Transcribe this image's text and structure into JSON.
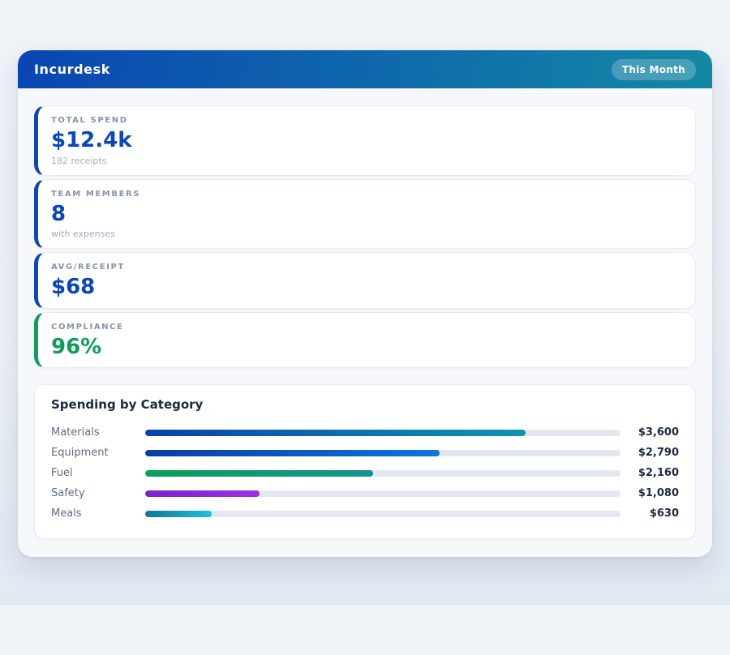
{
  "app": {
    "title": "Incurdesk",
    "period_badge": "This Month"
  },
  "theme": {
    "header_gradient": [
      "#0a45b2",
      "#1389a4"
    ],
    "page_background": "#eef1f6",
    "accent_blue": "#0b46bb",
    "accent_green": "#0f9d58",
    "track_color": "#e3e8f0"
  },
  "stats": [
    {
      "label": "TOTAL SPEND",
      "value": "$12.4k",
      "sub": "182 receipts",
      "accent": "#0b46bb"
    },
    {
      "label": "TEAM MEMBERS",
      "value": "8",
      "sub": "with expenses",
      "accent": "#0b46bb"
    },
    {
      "label": "AVG/RECEIPT",
      "value": "$68",
      "sub": "",
      "accent": "#0b46bb"
    },
    {
      "label": "COMPLIANCE",
      "value": "96%",
      "sub": "",
      "accent": "#0f9d58"
    }
  ],
  "chart_data": {
    "type": "bar",
    "orientation": "horizontal",
    "title": "Spending by Category",
    "categories": [
      "Materials",
      "Equipment",
      "Fuel",
      "Safety",
      "Meals"
    ],
    "values": [
      3600,
      2790,
      2160,
      1080,
      630
    ],
    "value_labels": [
      "$3,600",
      "$2,790",
      "$2,160",
      "$1,080",
      "$630"
    ],
    "axis_max": 4500,
    "grid": false,
    "legend_position": "none",
    "bar_gradients": [
      [
        "#0a40b0",
        "#0d97ac"
      ],
      [
        "#0a3da6",
        "#0b76da"
      ],
      [
        "#0c9e59",
        "#16928e"
      ],
      [
        "#7a23cf",
        "#9a31e6"
      ],
      [
        "#107795",
        "#1ec1dc"
      ]
    ]
  }
}
